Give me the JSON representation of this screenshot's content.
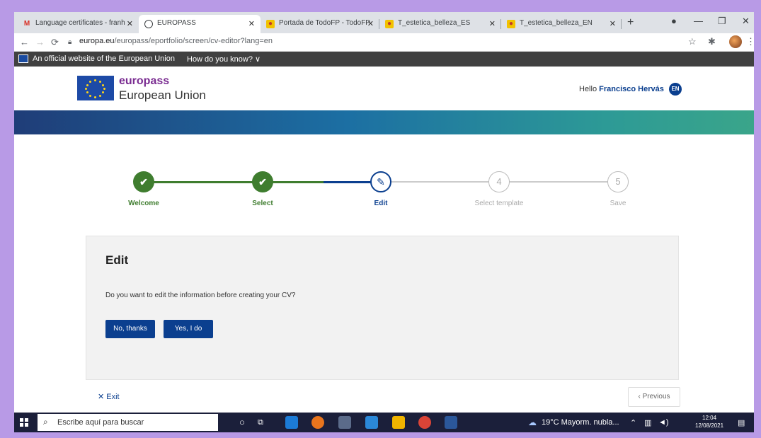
{
  "browser": {
    "tabs": [
      {
        "label": "Language certificates - franh",
        "icon": "gmail-icon"
      },
      {
        "label": "EUROPASS",
        "icon": "europass-icon"
      },
      {
        "label": "Portada de TodoFP - TodoFP",
        "icon": "todofp-icon"
      },
      {
        "label": "T_estetica_belleza_ES",
        "icon": "todofp-icon"
      },
      {
        "label": "T_estetica_belleza_EN",
        "icon": "todofp-icon"
      }
    ],
    "url_domain": "europa.eu",
    "url_path": "/europass/eportfolio/screen/cv-editor?lang=en"
  },
  "eu_banner": {
    "text": "An official website of the European Union",
    "how_link": "How do you know? ∨"
  },
  "header": {
    "brand_top": "europass",
    "brand_bottom": "European Union",
    "hello": "Hello",
    "user_name": "Francisco Hervás",
    "language": "EN"
  },
  "stepper": {
    "steps": [
      {
        "label": "Welcome",
        "state": "done",
        "mark": "✔"
      },
      {
        "label": "Select",
        "state": "done",
        "mark": "✔"
      },
      {
        "label": "Edit",
        "state": "current",
        "mark": "✎"
      },
      {
        "label": "Select template",
        "state": "todo",
        "mark": "4"
      },
      {
        "label": "Save",
        "state": "todo",
        "mark": "5"
      }
    ]
  },
  "card": {
    "title": "Edit",
    "question": "Do you want to edit the information before creating your CV?",
    "no_label": "No, thanks",
    "yes_label": "Yes, I do"
  },
  "footer": {
    "exit_label": "✕  Exit",
    "previous_label": "‹  Previous"
  },
  "taskbar": {
    "search_placeholder": "Escribe aquí para buscar",
    "weather": "19°C  Mayorm. nubla...",
    "time": "12:04",
    "date": "12/08/2021"
  },
  "colors": {
    "primary": "#0b3f8f",
    "done": "#3f7d2f",
    "brand": "#7a2c91",
    "frame": "#b89ae6"
  }
}
